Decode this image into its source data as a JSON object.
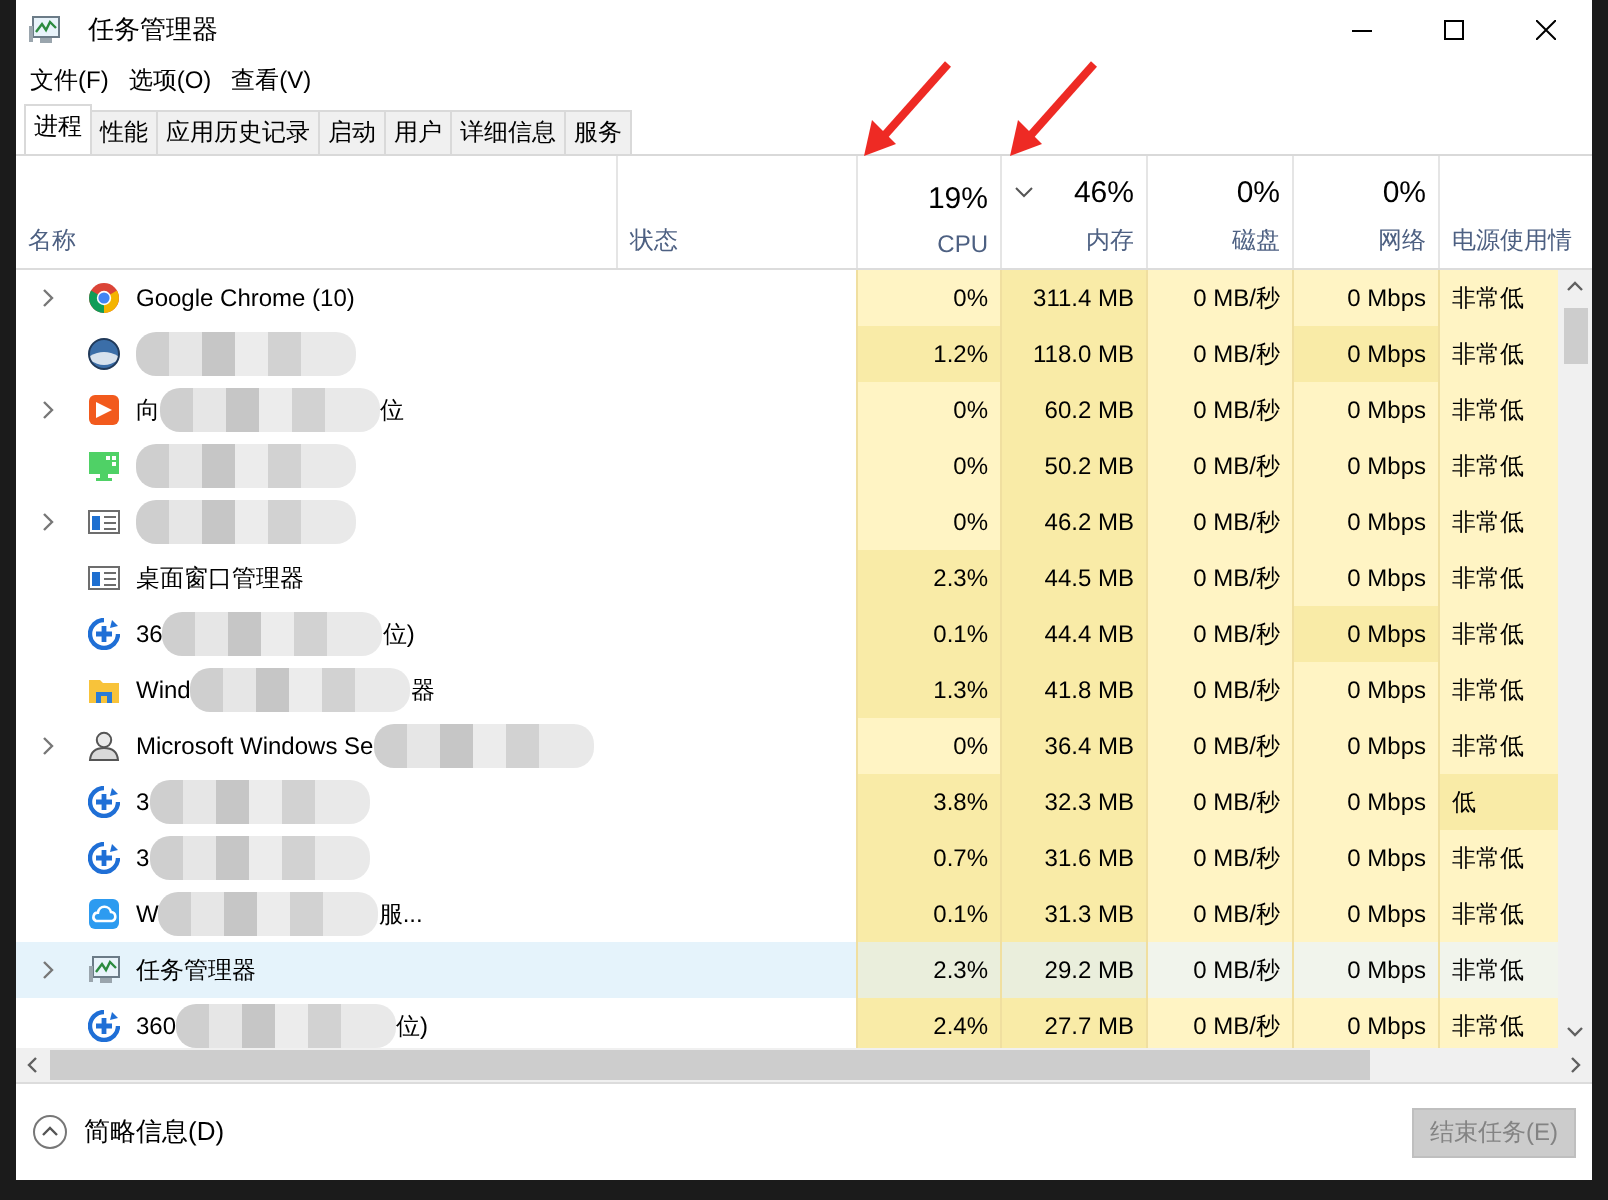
{
  "window": {
    "title": "任务管理器"
  },
  "menu": [
    {
      "label": "文件(F)"
    },
    {
      "label": "选项(O)"
    },
    {
      "label": "查看(V)"
    }
  ],
  "tabs": [
    {
      "label": "进程",
      "selected": true
    },
    {
      "label": "性能",
      "selected": false
    },
    {
      "label": "应用历史记录",
      "selected": false
    },
    {
      "label": "启动",
      "selected": false
    },
    {
      "label": "用户",
      "selected": false
    },
    {
      "label": "详细信息",
      "selected": false
    },
    {
      "label": "服务",
      "selected": false
    }
  ],
  "columns": [
    {
      "label": "名称",
      "kind": "name"
    },
    {
      "label": "状态",
      "kind": "status"
    },
    {
      "label": "CPU",
      "total": "19%",
      "kind": "metric",
      "sorted": false
    },
    {
      "label": "内存",
      "total": "46%",
      "kind": "metric",
      "sorted": true
    },
    {
      "label": "磁盘",
      "total": "0%",
      "kind": "metric",
      "sorted": false
    },
    {
      "label": "网络",
      "total": "0%",
      "kind": "metric",
      "sorted": false
    },
    {
      "label": "电源使用情",
      "kind": "power"
    }
  ],
  "annotations": [
    {
      "kind": "arrow"
    },
    {
      "kind": "arrow"
    }
  ],
  "rows": [
    {
      "kind": "chrome",
      "expandable": true,
      "selected": false,
      "name_start": "Google Chrome (10)",
      "redacted": false,
      "cells": [
        {
          "text": "0%",
          "hot": false
        },
        {
          "text": "311.4 MB",
          "hot": true
        },
        {
          "text": "0 MB/秒",
          "hot": false
        },
        {
          "text": "0 Mbps",
          "hot": false
        },
        {
          "text": "非常低",
          "hot": false
        }
      ]
    },
    {
      "kind": "globe",
      "expandable": false,
      "selected": false,
      "redacted": true,
      "cells": [
        {
          "text": "1.2%",
          "hot": true
        },
        {
          "text": "118.0 MB",
          "hot": true
        },
        {
          "text": "0 MB/秒",
          "hot": false
        },
        {
          "text": "0 Mbps",
          "hot": true
        },
        {
          "text": "非常低",
          "hot": false
        }
      ]
    },
    {
      "kind": "orange",
      "expandable": true,
      "selected": false,
      "name_start": "向",
      "redacted": true,
      "name_end": "位",
      "cells": [
        {
          "text": "0%",
          "hot": false
        },
        {
          "text": "60.2 MB",
          "hot": true
        },
        {
          "text": "0 MB/秒",
          "hot": false
        },
        {
          "text": "0 Mbps",
          "hot": false
        },
        {
          "text": "非常低",
          "hot": false
        }
      ]
    },
    {
      "kind": "monitor",
      "expandable": false,
      "selected": false,
      "redacted": true,
      "cells": [
        {
          "text": "0%",
          "hot": false
        },
        {
          "text": "50.2 MB",
          "hot": true
        },
        {
          "text": "0 MB/秒",
          "hot": false
        },
        {
          "text": "0 Mbps",
          "hot": false
        },
        {
          "text": "非常低",
          "hot": false
        }
      ]
    },
    {
      "kind": "window",
      "expandable": true,
      "selected": false,
      "redacted": true,
      "cells": [
        {
          "text": "0%",
          "hot": false
        },
        {
          "text": "46.2 MB",
          "hot": true
        },
        {
          "text": "0 MB/秒",
          "hot": false
        },
        {
          "text": "0 Mbps",
          "hot": false
        },
        {
          "text": "非常低",
          "hot": false
        }
      ]
    },
    {
      "kind": "window",
      "expandable": false,
      "selected": false,
      "name_start": "桌面窗口管理器",
      "redacted": false,
      "cells": [
        {
          "text": "2.3%",
          "hot": true
        },
        {
          "text": "44.5 MB",
          "hot": true
        },
        {
          "text": "0 MB/秒",
          "hot": false
        },
        {
          "text": "0 Mbps",
          "hot": false
        },
        {
          "text": "非常低",
          "hot": false
        }
      ]
    },
    {
      "kind": "shield",
      "expandable": false,
      "selected": false,
      "name_start": "36",
      "redacted": true,
      "name_end": "位)",
      "cells": [
        {
          "text": "0.1%",
          "hot": true
        },
        {
          "text": "44.4 MB",
          "hot": true
        },
        {
          "text": "0 MB/秒",
          "hot": false
        },
        {
          "text": "0 Mbps",
          "hot": true
        },
        {
          "text": "非常低",
          "hot": false
        }
      ]
    },
    {
      "kind": "folder",
      "expandable": false,
      "selected": false,
      "name_start": "Wind",
      "redacted": true,
      "name_end": "器",
      "cells": [
        {
          "text": "1.3%",
          "hot": true
        },
        {
          "text": "41.8 MB",
          "hot": true
        },
        {
          "text": "0 MB/秒",
          "hot": false
        },
        {
          "text": "0 Mbps",
          "hot": false
        },
        {
          "text": "非常低",
          "hot": false
        }
      ]
    },
    {
      "kind": "user",
      "expandable": true,
      "selected": false,
      "name_start": "Microsoft Windows Se",
      "redacted": true,
      "cells": [
        {
          "text": "0%",
          "hot": false
        },
        {
          "text": "36.4 MB",
          "hot": true
        },
        {
          "text": "0 MB/秒",
          "hot": false
        },
        {
          "text": "0 Mbps",
          "hot": false
        },
        {
          "text": "非常低",
          "hot": false
        }
      ]
    },
    {
      "kind": "shield",
      "expandable": false,
      "selected": false,
      "name_start": "3",
      "redacted": true,
      "cells": [
        {
          "text": "3.8%",
          "hot": true
        },
        {
          "text": "32.3 MB",
          "hot": true
        },
        {
          "text": "0 MB/秒",
          "hot": false
        },
        {
          "text": "0 Mbps",
          "hot": false
        },
        {
          "text": "低",
          "hot": true
        }
      ]
    },
    {
      "kind": "shield",
      "expandable": false,
      "selected": false,
      "name_start": "3",
      "redacted": true,
      "cells": [
        {
          "text": "0.7%",
          "hot": true
        },
        {
          "text": "31.6 MB",
          "hot": true
        },
        {
          "text": "0 MB/秒",
          "hot": false
        },
        {
          "text": "0 Mbps",
          "hot": false
        },
        {
          "text": "非常低",
          "hot": false
        }
      ]
    },
    {
      "kind": "cloud",
      "expandable": false,
      "selected": false,
      "name_start": "W",
      "redacted": true,
      "name_end": "服...",
      "cells": [
        {
          "text": "0.1%",
          "hot": true
        },
        {
          "text": "31.3 MB",
          "hot": true
        },
        {
          "text": "0 MB/秒",
          "hot": false
        },
        {
          "text": "0 Mbps",
          "hot": false
        },
        {
          "text": "非常低",
          "hot": false
        }
      ]
    },
    {
      "kind": "taskmgr",
      "expandable": true,
      "selected": true,
      "name_start": "任务管理器",
      "redacted": false,
      "cells": [
        {
          "text": "2.3%",
          "hot": true
        },
        {
          "text": "29.2 MB",
          "hot": true
        },
        {
          "text": "0 MB/秒",
          "hot": false
        },
        {
          "text": "0 Mbps",
          "hot": false
        },
        {
          "text": "非常低",
          "hot": false
        }
      ]
    },
    {
      "kind": "shield",
      "expandable": false,
      "selected": false,
      "name_start": "360",
      "redacted": true,
      "name_end": "位)",
      "cells": [
        {
          "text": "2.4%",
          "hot": true
        },
        {
          "text": "27.7 MB",
          "hot": true
        },
        {
          "text": "0 MB/秒",
          "hot": false
        },
        {
          "text": "0 Mbps",
          "hot": false
        },
        {
          "text": "非常低",
          "hot": false
        }
      ]
    }
  ],
  "footer": {
    "details_toggle": "简略信息(D)",
    "end_task": {
      "label": "结束任务(E)",
      "disabled": true
    }
  }
}
